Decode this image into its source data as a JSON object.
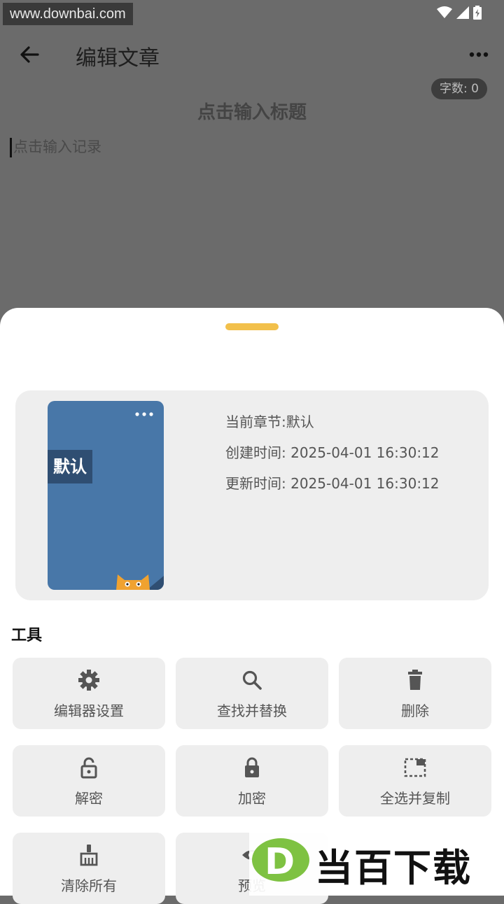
{
  "status_bar": {
    "watermark": "www.downbai.com"
  },
  "appbar": {
    "title": "编辑文章"
  },
  "editor": {
    "word_count": "字数: 0",
    "title_placeholder": "点击输入标题",
    "body_placeholder": "点击输入记录"
  },
  "chapter": {
    "cover_label": "默认",
    "current": "当前章节:默认",
    "created": "创建时间: 2025-04-01 16:30:12",
    "updated": "更新时间: 2025-04-01 16:30:12"
  },
  "tools": {
    "title": "工具",
    "items": [
      {
        "label": "编辑器设置",
        "icon": "gear-icon"
      },
      {
        "label": "查找并替换",
        "icon": "search-icon"
      },
      {
        "label": "删除",
        "icon": "trash-icon"
      },
      {
        "label": "解密",
        "icon": "unlock-icon"
      },
      {
        "label": "加密",
        "icon": "lock-icon"
      },
      {
        "label": "全选并复制",
        "icon": "select-all-icon"
      },
      {
        "label": "清除所有",
        "icon": "broom-icon"
      },
      {
        "label": "预览",
        "icon": "eye-icon"
      }
    ]
  },
  "watermark": {
    "text": "当百下载",
    "logo_letter": "D"
  },
  "colors": {
    "accent": "#f2c04b",
    "cover": "#4877a8",
    "tile_bg": "#eeeeee",
    "overlay": "#6b6b6b"
  }
}
